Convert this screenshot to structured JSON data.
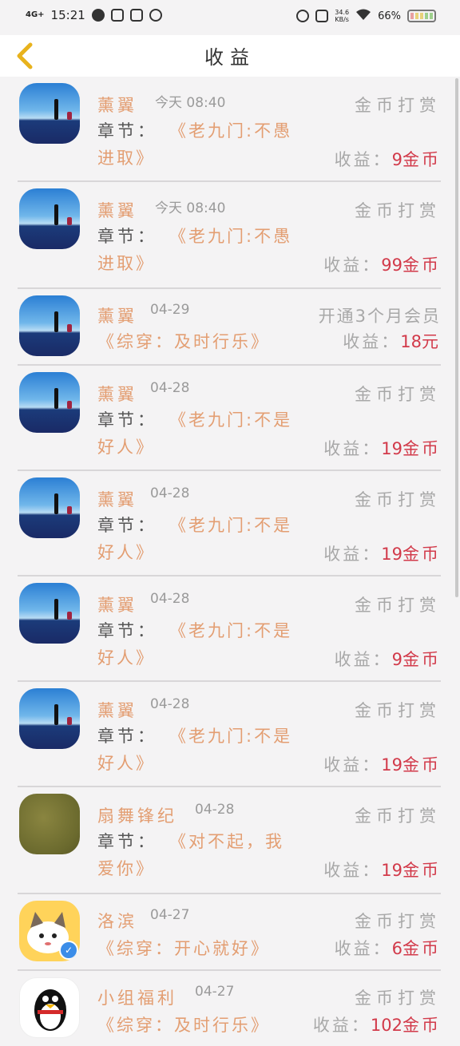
{
  "status_bar": {
    "network": "4G+",
    "time": "15:21",
    "speed_value": "34.6",
    "speed_unit": "KB/s",
    "battery": "66%"
  },
  "header": {
    "title": "收益",
    "back_icon": "chevron-left-icon"
  },
  "items": [
    {
      "avatar": "night-sky",
      "name": "薰翼",
      "time": "今天 08:40",
      "reward": "金币打赏",
      "chapter_label": "章节：",
      "chapter_line1": "《老九门:不愚",
      "chapter_line2": "进取》",
      "income_label": "收益：",
      "amount": "9",
      "unit": "金币"
    },
    {
      "avatar": "night-sky",
      "name": "薰翼",
      "time": "今天 08:40",
      "reward": "金币打赏",
      "chapter_label": "章节：",
      "chapter_line1": "《老九门:不愚",
      "chapter_line2": "进取》",
      "income_label": "收益：",
      "amount": "99",
      "unit": "金币"
    },
    {
      "avatar": "night-sky",
      "name": "薰翼",
      "time": "04-29",
      "reward": "开通3个月会员",
      "chapter_line1": "《综穿：及时行乐》",
      "income_label": "收益：",
      "amount": "18",
      "unit": "元"
    },
    {
      "avatar": "night-sky",
      "name": "薰翼",
      "time": "04-28",
      "reward": "金币打赏",
      "chapter_label": "章节：",
      "chapter_line1": "《老九门:不是",
      "chapter_line2": "好人》",
      "income_label": "收益：",
      "amount": "19",
      "unit": "金币"
    },
    {
      "avatar": "night-sky",
      "name": "薰翼",
      "time": "04-28",
      "reward": "金币打赏",
      "chapter_label": "章节：",
      "chapter_line1": "《老九门:不是",
      "chapter_line2": "好人》",
      "income_label": "收益：",
      "amount": "19",
      "unit": "金币"
    },
    {
      "avatar": "night-sky",
      "name": "薰翼",
      "time": "04-28",
      "reward": "金币打赏",
      "chapter_label": "章节：",
      "chapter_line1": "《老九门:不是",
      "chapter_line2": "好人》",
      "income_label": "收益：",
      "amount": "9",
      "unit": "金币"
    },
    {
      "avatar": "night-sky",
      "name": "薰翼",
      "time": "04-28",
      "reward": "金币打赏",
      "chapter_label": "章节：",
      "chapter_line1": "《老九门:不是",
      "chapter_line2": "好人》",
      "income_label": "收益：",
      "amount": "19",
      "unit": "金币"
    },
    {
      "avatar": "olive",
      "name": "扇舞锋纪",
      "time": "04-28",
      "reward": "金币打赏",
      "chapter_label": "章节：",
      "chapter_line1": "《对不起，我",
      "chapter_line2": "爱你》",
      "income_label": "收益：",
      "amount": "19",
      "unit": "金币"
    },
    {
      "avatar": "cat",
      "name": "洛滨",
      "time": "04-27",
      "reward": "金币打赏",
      "chapter_line1": "《综穿：开心就好》",
      "income_label": "收益：",
      "amount": "6",
      "unit": "金币"
    },
    {
      "avatar": "qq",
      "name": "小组福利",
      "time": "04-27",
      "reward": "金币打赏",
      "chapter_line1": "《综穿：及时行乐》",
      "income_label": "收益：",
      "amount": "102",
      "unit": "金币"
    }
  ]
}
